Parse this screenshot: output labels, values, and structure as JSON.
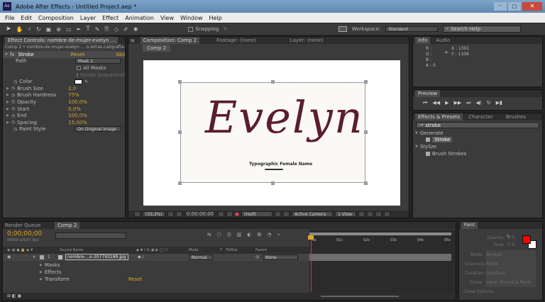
{
  "titlebar": {
    "title": "Adobe After Effects - Untitled Project.aep *"
  },
  "menu": [
    "File",
    "Edit",
    "Composition",
    "Layer",
    "Effect",
    "Animation",
    "View",
    "Window",
    "Help"
  ],
  "toolbar": {
    "snapping": "Snapping",
    "workspace_label": "Workspace:",
    "workspace_value": "Standard",
    "search_placeholder": "Search Help"
  },
  "effect_controls": {
    "tab": "Effect Controls: nombre-de-mujer-evelyn ...",
    "breadcrumb": "Comp 2 • nombre-de-mujer-evelyn ... o-letras-caligrafia-texto",
    "fx_label": "fx",
    "effect_name": "Stroke",
    "reset": "Reset",
    "about": "Abo",
    "path_label": "Path",
    "path_value": "Mask 1",
    "all_masks": "All Masks",
    "stroke_seq": "Stroke Sequentially",
    "props": [
      {
        "name": "Color",
        "value": ""
      },
      {
        "name": "Brush Size",
        "value": "2,0"
      },
      {
        "name": "Brush Hardness",
        "value": "75%"
      },
      {
        "name": "Opacity",
        "value": "100,0%"
      },
      {
        "name": "Start",
        "value": "0,0%"
      },
      {
        "name": "End",
        "value": "100,0%"
      },
      {
        "name": "Spacing",
        "value": "15,00%"
      }
    ],
    "paint_style_label": "Paint Style",
    "paint_style_value": "On Original Image"
  },
  "composition": {
    "tab": "Composition: Comp 2",
    "footage_tab": "Footage: (none)",
    "layer_tab": "Layer: (none)",
    "comp_tab": "Comp 2",
    "script_text": "Evelyn",
    "caption": "Typographic Female Name",
    "zoom": "(33,3%)",
    "timecode": "0;00;00;00",
    "resolution": "(Half)",
    "camera": "Active Camera",
    "view": "1 View"
  },
  "info": {
    "tab": "Info",
    "audio_tab": "Audio",
    "r": "R :",
    "g": "G :",
    "b": "B :",
    "a": "A : 0",
    "x": "X : 1301",
    "y": "Y : 1106"
  },
  "preview": {
    "tab": "Preview"
  },
  "effects_presets": {
    "tab": "Effects & Presets",
    "character_tab": "Character",
    "brushes_tab": "Brushes",
    "search_value": "stroke",
    "groups": [
      {
        "name": "Generate",
        "items": [
          "Stroke"
        ]
      },
      {
        "name": "Stylize",
        "items": [
          "Brush Strokes"
        ]
      }
    ]
  },
  "timeline": {
    "render_queue_tab": "Render Queue",
    "comp_tab": "Comp 2",
    "timecode": "0;00;00;00",
    "fps": "00000 (29.97 fps)",
    "columns": {
      "source_name": "Source Name",
      "mode": "Mode",
      "t": "T",
      "trkmat": "TrkMat",
      "parent": "Parent"
    },
    "layer": {
      "index": "1",
      "name": "nombre-...o-207793189.jpg",
      "mode": "Normal",
      "parent": "None"
    },
    "sub": [
      "Masks",
      "Effects",
      "Transform"
    ],
    "transform_reset": "Reset",
    "ruler": [
      "0s",
      "01s",
      "02s",
      "03s",
      "04s",
      "05s"
    ]
  },
  "paint": {
    "tab": "Paint",
    "opacity_label": "Opacity:",
    "opacity_value": "0 %",
    "flow_label": "Flow:",
    "flow_value": "0 %",
    "mode_label": "Mode:",
    "mode_value": "Normal",
    "channels_label": "Channels:",
    "channels_value": "RGBA",
    "duration_label": "Duration:",
    "duration_value": "Constant",
    "erase_label": "Erase:",
    "erase_value": "Layer Source & Paint",
    "clone_options": "Clone Options",
    "fg_color": "#ff0000",
    "bg_color": "#ffffff"
  }
}
